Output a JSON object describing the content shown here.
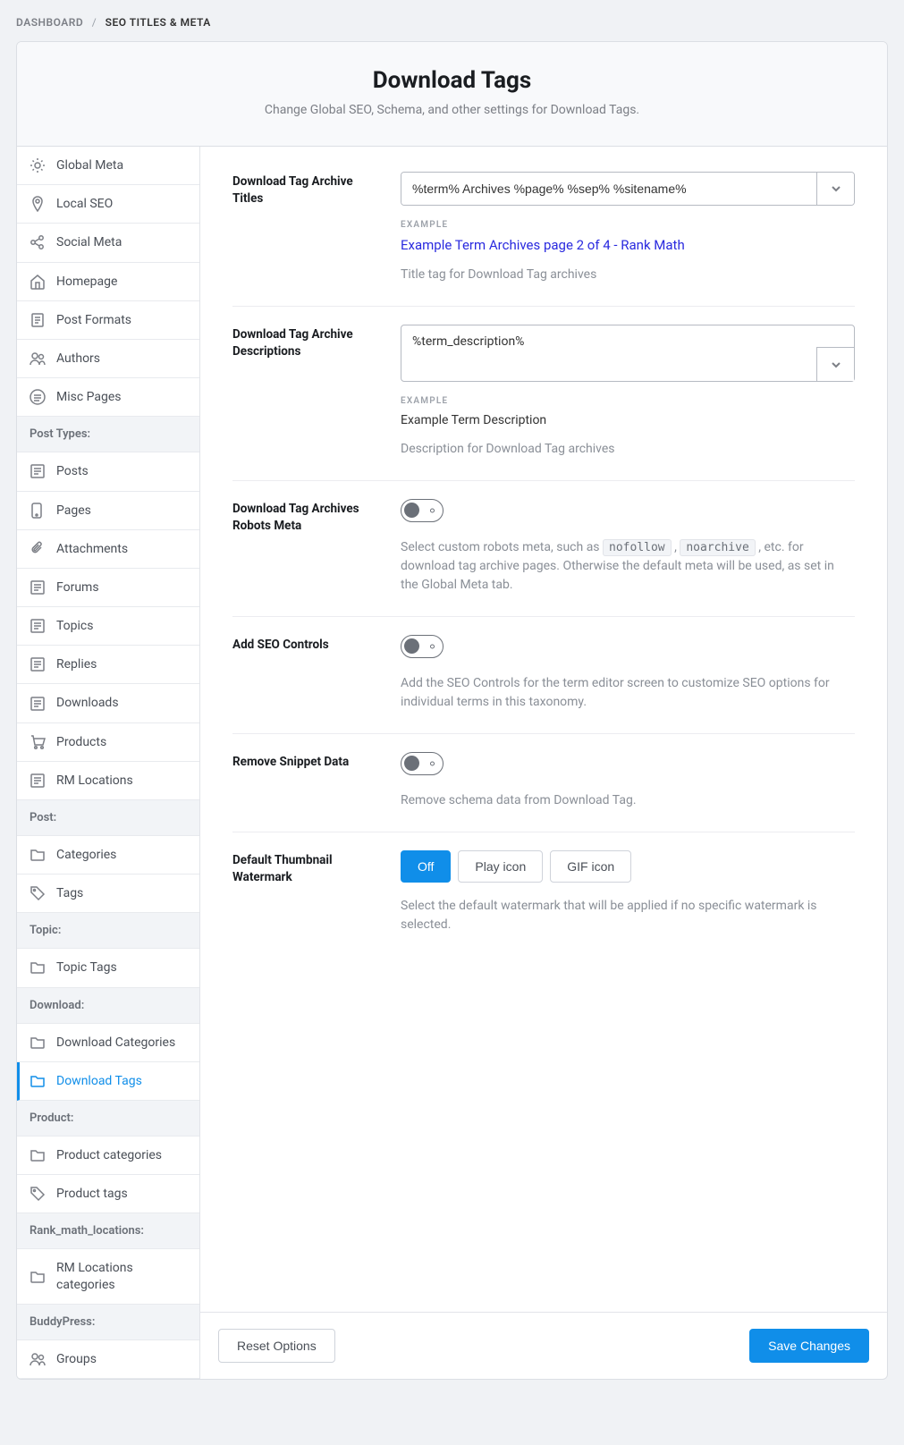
{
  "breadcrumb": {
    "root": "DASHBOARD",
    "current": "SEO TITLES & META"
  },
  "header": {
    "title": "Download Tags",
    "subtitle": "Change Global SEO, Schema, and other settings for Download Tags."
  },
  "sidebar": {
    "top": [
      {
        "id": "global-meta",
        "label": "Global Meta",
        "icon": "gear"
      },
      {
        "id": "local-seo",
        "label": "Local SEO",
        "icon": "pin"
      },
      {
        "id": "social-meta",
        "label": "Social Meta",
        "icon": "share"
      },
      {
        "id": "homepage",
        "label": "Homepage",
        "icon": "home"
      },
      {
        "id": "post-formats",
        "label": "Post Formats",
        "icon": "doc"
      },
      {
        "id": "authors",
        "label": "Authors",
        "icon": "users"
      },
      {
        "id": "misc-pages",
        "label": "Misc Pages",
        "icon": "list"
      }
    ],
    "sections": [
      {
        "title": "Post Types:",
        "items": [
          {
            "id": "posts",
            "label": "Posts",
            "icon": "post"
          },
          {
            "id": "pages",
            "label": "Pages",
            "icon": "page"
          },
          {
            "id": "attachments",
            "label": "Attachments",
            "icon": "attach"
          },
          {
            "id": "forums",
            "label": "Forums",
            "icon": "post"
          },
          {
            "id": "topics",
            "label": "Topics",
            "icon": "post"
          },
          {
            "id": "replies",
            "label": "Replies",
            "icon": "post"
          },
          {
            "id": "downloads",
            "label": "Downloads",
            "icon": "post"
          },
          {
            "id": "products",
            "label": "Products",
            "icon": "cart"
          },
          {
            "id": "rm-locations",
            "label": "RM Locations",
            "icon": "post"
          }
        ]
      },
      {
        "title": "Post:",
        "items": [
          {
            "id": "categories",
            "label": "Categories",
            "icon": "folder"
          },
          {
            "id": "tags",
            "label": "Tags",
            "icon": "tag"
          }
        ]
      },
      {
        "title": "Topic:",
        "items": [
          {
            "id": "topic-tags",
            "label": "Topic Tags",
            "icon": "folder"
          }
        ]
      },
      {
        "title": "Download:",
        "items": [
          {
            "id": "download-categories",
            "label": "Download Categories",
            "icon": "folder"
          },
          {
            "id": "download-tags",
            "label": "Download Tags",
            "icon": "folder",
            "active": true
          }
        ]
      },
      {
        "title": "Product:",
        "items": [
          {
            "id": "product-categories",
            "label": "Product categories",
            "icon": "folder"
          },
          {
            "id": "product-tags",
            "label": "Product tags",
            "icon": "tag"
          }
        ]
      },
      {
        "title": "Rank_math_locations:",
        "items": [
          {
            "id": "rm-locations-categories",
            "label": "RM Locations categories",
            "icon": "folder"
          }
        ]
      },
      {
        "title": "BuddyPress:",
        "items": [
          {
            "id": "groups",
            "label": "Groups",
            "icon": "users"
          }
        ]
      }
    ]
  },
  "fields": {
    "titles": {
      "label": "Download Tag Archive Titles",
      "value": "%term% Archives %page% %sep% %sitename%",
      "example_label": "EXAMPLE",
      "example_text": "Example Term Archives page 2 of 4 - Rank Math",
      "help": "Title tag for Download Tag archives"
    },
    "descriptions": {
      "label": "Download Tag Archive Descriptions",
      "value": "%term_description%",
      "example_label": "EXAMPLE",
      "example_text": "Example Term Description",
      "help": "Description for Download Tag archives"
    },
    "robots": {
      "label": "Download Tag Archives Robots Meta",
      "help_pre": "Select custom robots meta, such as ",
      "code1": "nofollow",
      "help_mid": " , ",
      "code2": "noarchive",
      "help_post": " , etc. for download tag archive pages. Otherwise the default meta will be used, as set in the Global Meta tab."
    },
    "seo_controls": {
      "label": "Add SEO Controls",
      "help": "Add the SEO Controls for the term editor screen to customize SEO options for individual terms in this taxonomy."
    },
    "snippet": {
      "label": "Remove Snippet Data",
      "help": "Remove schema data from Download Tag."
    },
    "watermark": {
      "label": "Default Thumbnail Watermark",
      "options": [
        {
          "label": "Off",
          "active": true
        },
        {
          "label": "Play icon"
        },
        {
          "label": "GIF icon"
        }
      ],
      "help": "Select the default watermark that will be applied if no specific watermark is selected."
    }
  },
  "footer": {
    "reset": "Reset Options",
    "save": "Save Changes"
  }
}
